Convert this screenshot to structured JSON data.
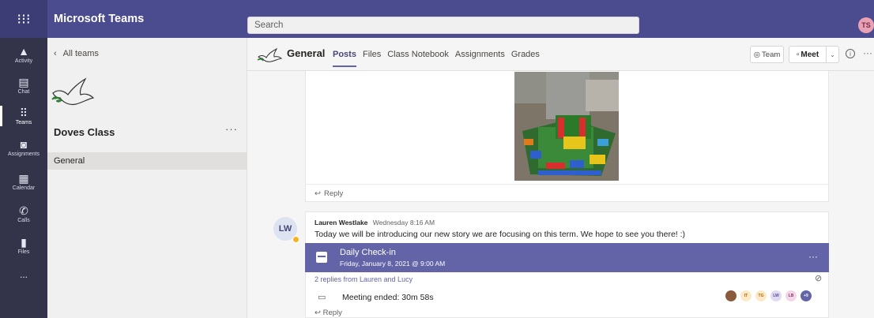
{
  "app": {
    "title": "Microsoft Teams",
    "user_initials": "TS"
  },
  "search": {
    "placeholder": "Search"
  },
  "rail": [
    {
      "label": "Activity",
      "icon": "bell-icon"
    },
    {
      "label": "Chat",
      "icon": "chat-icon"
    },
    {
      "label": "Teams",
      "icon": "teams-icon"
    },
    {
      "label": "Assignments",
      "icon": "backpack-icon"
    },
    {
      "label": "Calendar",
      "icon": "calendar-icon"
    },
    {
      "label": "Calls",
      "icon": "phone-icon"
    },
    {
      "label": "Files",
      "icon": "file-icon"
    },
    {
      "label": "...",
      "icon": "more-icon"
    }
  ],
  "left": {
    "back_label": "All teams",
    "team_name": "Doves Class",
    "channel": "General"
  },
  "header": {
    "channel_title": "General",
    "tabs": [
      "Posts",
      "Files",
      "Class Notebook",
      "Assignments",
      "Grades"
    ],
    "team_btn": "Team",
    "meet_btn": "Meet"
  },
  "post1": {
    "reply_label": "Reply"
  },
  "post2": {
    "avatar_initials": "LW",
    "author": "Lauren Westlake",
    "time": "Wednesday 8:16 AM",
    "message": "Today we will be introducing our new story we are focusing on this term. We hope to see you there! :)",
    "meeting": {
      "title": "Daily Check-in",
      "datetime": "Friday, January 8, 2021 @ 9:00 AM"
    },
    "replies": "2 replies from Lauren and Lucy",
    "ended": "Meeting ended: 30m 58s",
    "participants": [
      {
        "initials": "",
        "bg": "#8a5a3c",
        "fg": "#ffffff"
      },
      {
        "initials": "IT",
        "bg": "#fde9c7",
        "fg": "#a36b00"
      },
      {
        "initials": "TG",
        "bg": "#fde9c7",
        "fg": "#a36b00"
      },
      {
        "initials": "LW",
        "bg": "#e2d9f3",
        "fg": "#5b4a8a"
      },
      {
        "initials": "LB",
        "bg": "#f3d6e8",
        "fg": "#8a3a6a"
      },
      {
        "initials": "+9",
        "bg": "#6264a7",
        "fg": "#ffffff"
      }
    ],
    "reply_label": "Reply"
  }
}
